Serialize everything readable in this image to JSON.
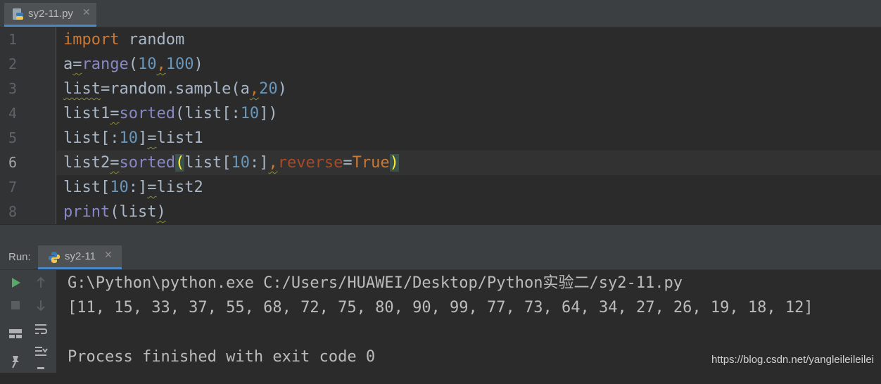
{
  "editor": {
    "tab": {
      "filename": "sy2-11.py",
      "close": "✕"
    },
    "line_numbers": [
      "1",
      "2",
      "3",
      "4",
      "5",
      "6",
      "7",
      "8"
    ],
    "current_line": 6
  },
  "run_panel": {
    "label": "Run:",
    "tab": {
      "name": "sy2-11",
      "close": "✕"
    },
    "console": [
      "G:\\Python\\python.exe C:/Users/HUAWEI/Desktop/Python实验二/sy2-11.py",
      "[11, 15, 33, 37, 55, 68, 72, 75, 80, 90, 99, 77, 73, 64, 34, 27, 26, 19, 18, 12]",
      "",
      "Process finished with exit code 0"
    ]
  },
  "watermark": "https://blog.csdn.net/yangleileileilei",
  "code": {
    "l1": {
      "kw": "import",
      "rest": " random"
    },
    "l2": {
      "a": "a",
      "eq": "=",
      "fn": "range",
      "open": "(",
      "n1": "10",
      "comma": ",",
      "n2": "100",
      "close": ")"
    },
    "l3": {
      "var": "list",
      "eq": "=",
      "mid": "random.sample(a",
      "comma": ",",
      "n": "20",
      "close": ")"
    },
    "l4": {
      "var": "list1",
      "eq": "=",
      "fn": "sorted",
      "mid": "(list[:",
      "n": "10",
      "close": "])"
    },
    "l5": {
      "pre": "list[:",
      "n": "10",
      "mid": "]",
      "eq": "=",
      "rest": "list1"
    },
    "l6": {
      "var": "list2",
      "eq": "=",
      "fn": "sorted",
      "open": "(",
      "mid": "list[",
      "n": "10",
      "mid2": ":]",
      "comma": ",",
      "param": "reverse",
      "eq2": "=",
      "kw": "True",
      "close": ")"
    },
    "l7": {
      "pre": "list[",
      "n": "10",
      "mid": ":]",
      "eq": "=",
      "rest": "list2"
    },
    "l8": {
      "fn": "print",
      "open": "(",
      "var": "list",
      "close": ")"
    }
  },
  "colors": {
    "background": "#2b2b2b",
    "keyword": "#cc7832",
    "builtin": "#8888c6",
    "number": "#6897bb",
    "param": "#aa4926",
    "text": "#a9b7c6",
    "run_green": "#59a869",
    "tab_underline": "#4a88c7"
  },
  "icons": {
    "tab": "python-file-icon",
    "toolbar": [
      "run-icon",
      "stop-icon",
      "layout-icon",
      "pin-icon",
      "up-arrow-icon",
      "down-arrow-icon",
      "soft-wrap-icon",
      "scroll-to-end-icon",
      "trash-icon"
    ]
  }
}
